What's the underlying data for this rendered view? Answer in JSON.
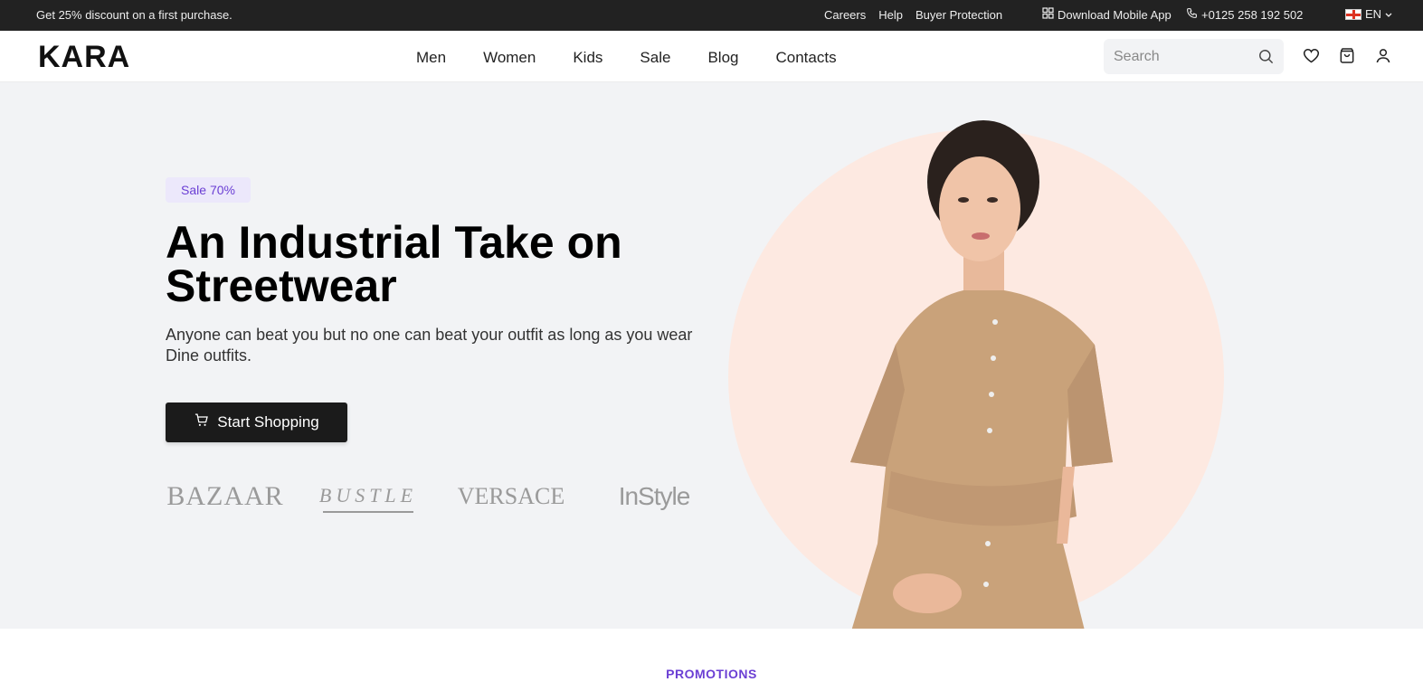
{
  "topbar": {
    "promo": "Get 25% discount on a first purchase.",
    "links": [
      "Careers",
      "Help",
      "Buyer Protection"
    ],
    "app_label": "Download Mobile App",
    "phone": "+0125 258 192 502",
    "language": "EN"
  },
  "header": {
    "logo": "KARA",
    "nav": [
      "Men",
      "Women",
      "Kids",
      "Sale",
      "Blog",
      "Contacts"
    ],
    "search_placeholder": "Search"
  },
  "hero": {
    "badge": "Sale 70%",
    "title": "An Industrial Take on Streetwear",
    "subtitle": "Anyone can beat you but no one can beat your outfit as long as you wear Dine outfits.",
    "cta": "Start Shopping",
    "brands": [
      "BAZAAR",
      "BUSTLE",
      "VERSACE",
      "InStyle"
    ]
  },
  "section": {
    "promotions_label": "PROMOTIONS"
  },
  "colors": {
    "topbar_bg": "#222222",
    "hero_bg": "#f2f3f5",
    "accent": "#6b3fd4",
    "circle": "#fde9e1",
    "cta_bg": "#1b1b1b"
  },
  "icons": [
    "grid-icon",
    "phone-icon",
    "flag-icon",
    "chevron-down-icon",
    "search-icon",
    "heart-icon",
    "bag-icon",
    "user-icon",
    "cart-icon"
  ]
}
